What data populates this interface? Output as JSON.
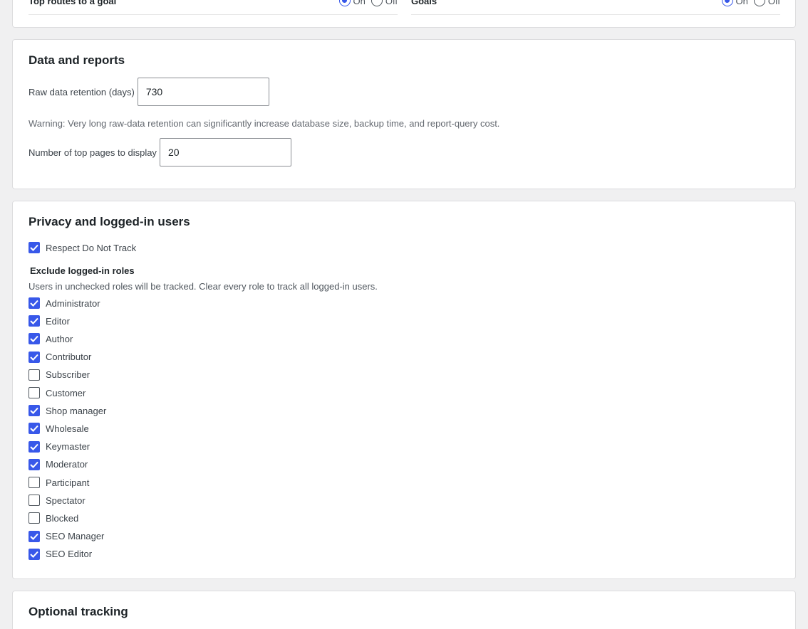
{
  "top_partial": {
    "left_label": "Top routes to a goal",
    "right_label": "Goals",
    "on_label": "On",
    "off_label": "Off"
  },
  "data_reports": {
    "title": "Data and reports",
    "retention_label": "Raw data retention (days)",
    "retention_value": "730",
    "warning": "Warning: Very long raw-data retention can significantly increase database size, backup time, and report-query cost.",
    "top_pages_label": "Number of top pages to display",
    "top_pages_value": "20"
  },
  "privacy": {
    "title": "Privacy and logged-in users",
    "dnt_label": "Respect Do Not Track",
    "dnt_checked": true,
    "exclude_heading": "Exclude logged-in roles",
    "help": "Users in unchecked roles will be tracked. Clear every role to track all logged-in users.",
    "roles": [
      {
        "label": "Administrator",
        "checked": true
      },
      {
        "label": "Editor",
        "checked": true
      },
      {
        "label": "Author",
        "checked": true
      },
      {
        "label": "Contributor",
        "checked": true
      },
      {
        "label": "Subscriber",
        "checked": false
      },
      {
        "label": "Customer",
        "checked": false
      },
      {
        "label": "Shop manager",
        "checked": true
      },
      {
        "label": "Wholesale",
        "checked": true
      },
      {
        "label": "Keymaster",
        "checked": true
      },
      {
        "label": "Moderator",
        "checked": true
      },
      {
        "label": "Participant",
        "checked": false
      },
      {
        "label": "Spectator",
        "checked": false
      },
      {
        "label": "Blocked",
        "checked": false
      },
      {
        "label": "SEO Manager",
        "checked": true
      },
      {
        "label": "SEO Editor",
        "checked": true
      }
    ]
  },
  "optional": {
    "title": "Optional tracking"
  },
  "colors": {
    "accent": "#3858e9",
    "background": "#f0f0f1"
  }
}
